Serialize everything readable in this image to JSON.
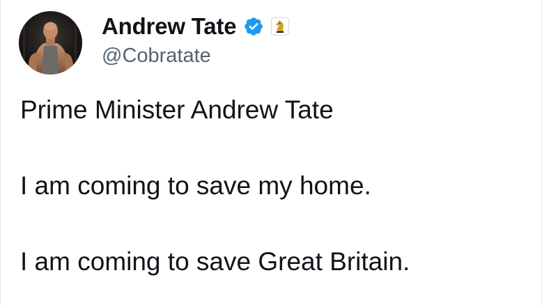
{
  "author": {
    "display_name": "Andrew Tate",
    "handle": "@Cobratate",
    "verified_icon": "verified-badge-icon",
    "affiliate_icon": "chess-knight-icon",
    "accent_color": "#1d9bf0"
  },
  "tweet": {
    "lines": [
      "Prime Minister Andrew Tate",
      "I am coming to save my home.",
      "I am coming to save Great Britain."
    ]
  }
}
